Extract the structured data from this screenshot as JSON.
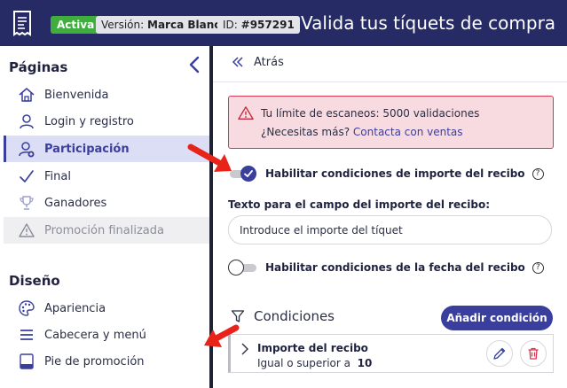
{
  "header": {
    "status_badge": "Activa",
    "version_label": "Versión:",
    "version_value": "Marca Blanca",
    "id_label": "ID:",
    "id_value": "#957291",
    "title": "Valida tus tíquets de compra"
  },
  "sidebar": {
    "pages_title": "Páginas",
    "pages": [
      {
        "label": "Bienvenida",
        "icon": "home-icon"
      },
      {
        "label": "Login y registro",
        "icon": "user-icon"
      },
      {
        "label": "Participación",
        "icon": "user-add-icon"
      },
      {
        "label": "Final",
        "icon": "check-icon"
      },
      {
        "label": "Ganadores",
        "icon": "trophy-icon"
      },
      {
        "label": "Promoción finalizada",
        "icon": "warning-icon"
      }
    ],
    "design_title": "Diseño",
    "design": [
      {
        "label": "Apariencia",
        "icon": "palette-icon"
      },
      {
        "label": "Cabecera y menú",
        "icon": "menu-icon"
      },
      {
        "label": "Pie de promoción",
        "icon": "footer-icon"
      }
    ]
  },
  "main": {
    "back_label": "Atrás",
    "alert": {
      "line1": "Tu límite de escaneos: 5000 validaciones",
      "line2_prefix": "¿Necesitas más?",
      "line2_link": "Contacta con ventas"
    },
    "toggle_amount_label": "Habilitar condiciones de importe del recibo",
    "field_label": "Texto para el campo del importe del recibo:",
    "field_value": "Introduce el importe del tíquet",
    "toggle_date_label": "Habilitar condiciones de la fecha del recibo",
    "conditions_title": "Condiciones",
    "add_button": "Añadir condición",
    "condition": {
      "title": "Importe del recibo",
      "desc_prefix": "Igual o superior a",
      "desc_value": "10"
    }
  },
  "colors": {
    "header_bg": "#262b66",
    "accent": "#3a3f9e",
    "active_badge": "#3fae3f",
    "alert_bg": "#f8dbe0",
    "alert_border": "#d9364f",
    "annotation_arrow": "#e8231a"
  }
}
